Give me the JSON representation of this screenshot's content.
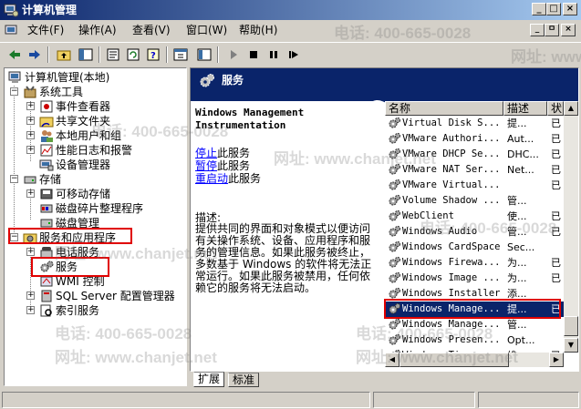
{
  "window": {
    "title": "计算机管理",
    "caption_buttons": [
      "_",
      "□",
      "×"
    ]
  },
  "menu": {
    "items": [
      {
        "label": "文件(F)"
      },
      {
        "label": "操作(A)"
      },
      {
        "label": "查看(V)"
      },
      {
        "label": "窗口(W)"
      },
      {
        "label": "帮助(H)"
      }
    ],
    "mdi_buttons": [
      "_",
      "ㅁ",
      "×"
    ]
  },
  "toolbar": {
    "icons": [
      "back-arrow-icon",
      "forward-arrow-icon",
      "up-folder-icon",
      "show-hide-tree-icon",
      "properties-icon",
      "refresh-icon",
      "help-icon",
      "export-icon",
      "play-icon",
      "stop-icon",
      "pause-icon",
      "restart-icon"
    ]
  },
  "tree": {
    "root": "计算机管理(本地)",
    "items": [
      {
        "label": "系统工具",
        "expander": "−",
        "level": 1
      },
      {
        "label": "事件查看器",
        "expander": "+",
        "level": 2
      },
      {
        "label": "共享文件夹",
        "expander": "+",
        "level": 2
      },
      {
        "label": "本地用户和组",
        "expander": "+",
        "level": 2
      },
      {
        "label": "性能日志和报警",
        "expander": "+",
        "level": 2
      },
      {
        "label": "设备管理器",
        "expander": "",
        "level": 2
      },
      {
        "label": "存储",
        "expander": "−",
        "level": 1
      },
      {
        "label": "可移动存储",
        "expander": "+",
        "level": 2
      },
      {
        "label": "磁盘碎片整理程序",
        "expander": "",
        "level": 2
      },
      {
        "label": "磁盘管理",
        "expander": "",
        "level": 2
      },
      {
        "label": "服务和应用程序",
        "expander": "−",
        "level": 1
      },
      {
        "label": "电话服务",
        "expander": "+",
        "level": 2
      },
      {
        "label": "服务",
        "expander": "",
        "level": 2
      },
      {
        "label": "WMI 控制",
        "expander": "",
        "level": 2
      },
      {
        "label": "SQL Server 配置管理器",
        "expander": "+",
        "level": 2
      },
      {
        "label": "索引服务",
        "expander": "+",
        "level": 2
      }
    ]
  },
  "right_header": {
    "title": "服务"
  },
  "service_detail": {
    "name_line1": "Windows Management",
    "name_line2": "Instrumentation",
    "stop_link": "停止",
    "stop_rest": "此服务",
    "pause_link": "暂停",
    "pause_rest": "此服务",
    "restart_link": "重启动",
    "restart_rest": "此服务",
    "desc_label": "描述:",
    "description": "提供共同的界面和对象模式以便访问有关操作系统、设备、应用程序和服务的管理信息。如果此服务被终止，多数基于 Windows 的软件将无法正常运行。如果此服务被禁用，任何依赖它的服务将无法启动。"
  },
  "list": {
    "columns": [
      "名称",
      "描述",
      "状"
    ],
    "rows": [
      {
        "name": "Virtual Disk S...",
        "desc": "提...",
        "status": "已"
      },
      {
        "name": "VMware Authori...",
        "desc": "Aut...",
        "status": "已"
      },
      {
        "name": "VMware DHCP Se...",
        "desc": "DHC...",
        "status": "已"
      },
      {
        "name": "VMware NAT Ser...",
        "desc": "Net...",
        "status": "已"
      },
      {
        "name": "VMware Virtual...",
        "desc": "",
        "status": "已"
      },
      {
        "name": "Volume Shadow ...",
        "desc": "管...",
        "status": ""
      },
      {
        "name": "WebClient",
        "desc": "使...",
        "status": "已"
      },
      {
        "name": "Windows Audio",
        "desc": "管...",
        "status": "已"
      },
      {
        "name": "Windows CardSpace",
        "desc": "Sec...",
        "status": ""
      },
      {
        "name": "Windows Firewa...",
        "desc": "为...",
        "status": "已"
      },
      {
        "name": "Windows Image ...",
        "desc": "为...",
        "status": "已"
      },
      {
        "name": "Windows Installer",
        "desc": "添...",
        "status": ""
      },
      {
        "name": "Windows Manage...",
        "desc": "提...",
        "status": "已",
        "selected": true
      },
      {
        "name": "Windows Manage...",
        "desc": "管...",
        "status": ""
      },
      {
        "name": "Windows Presen...",
        "desc": "Opt...",
        "status": ""
      },
      {
        "name": "Windows Time",
        "desc": "维...",
        "status": "已"
      }
    ]
  },
  "tabs": {
    "extended": "扩展",
    "standard": "标准"
  },
  "watermarks": {
    "phone": "电话: 400-665-0028",
    "site": "网址: www.chanjet.net"
  },
  "colors": {
    "titlebar_start": "#0a246a",
    "titlebar_end": "#a6caf0",
    "selection": "#0a246a",
    "highlight_box": "#e00000",
    "link": "#0000ff"
  }
}
